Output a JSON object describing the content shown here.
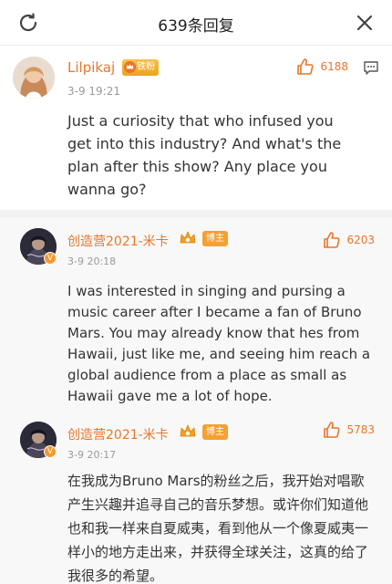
{
  "header": {
    "title": "639条回复"
  },
  "main_comment": {
    "username": "Lilpikaj",
    "vip_badge": "铁粉",
    "time": "3-9 19:21",
    "likes": "6188",
    "text": "Just a curiosity that who infused you get into this industry? And what's the plan after this show? Any place you wanna go?"
  },
  "replies": [
    {
      "username": "创造营2021-米卡",
      "badge": "博主",
      "time": "3-9 20:18",
      "likes": "6203",
      "text": "I was interested in singing and pursing a music career after I became a fan of Bruno Mars. You may already know that hes from Hawaii, just like me, and seeing him reach a global audience from a place as small as Hawaii gave me a lot of hope."
    },
    {
      "username": "创造营2021-米卡",
      "badge": "博主",
      "time": "3-9 20:17",
      "likes": "5783",
      "text": "在我成为Bruno Mars的粉丝之后，我开始对唱歌产生兴趣并追寻自己的音乐梦想。或许你们知道他也和我一样来自夏威夷，看到他从一个像夏威夷一样小的地方走出来，并获得全球关注，这真的给了我很多的希望。"
    }
  ],
  "colors": {
    "accent": "#e8762b",
    "badge": "#f4a033",
    "muted": "#9a9a9a",
    "reply_bg": "#f8f8f8"
  }
}
